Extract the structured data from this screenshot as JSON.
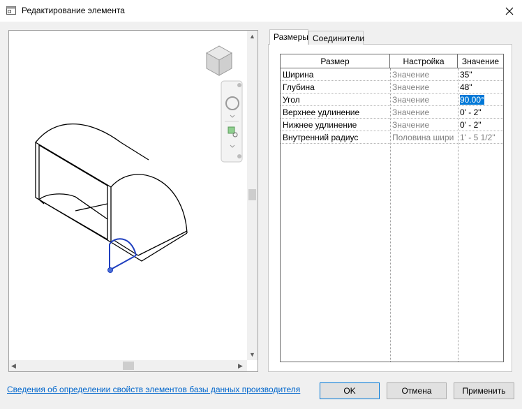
{
  "window": {
    "title": "Редактирование элемента"
  },
  "tabs": [
    {
      "label": "Размеры",
      "active": true
    },
    {
      "label": "Соединители",
      "active": false
    }
  ],
  "grid": {
    "columns": [
      "Размер",
      "Настройка",
      "Значение"
    ],
    "rows": [
      {
        "name": "Ширина",
        "setting": "Значение",
        "value": "35\""
      },
      {
        "name": "Глубина",
        "setting": "Значение",
        "value": "48\""
      },
      {
        "name": "Угол",
        "setting": "Значение",
        "value": "90.00°"
      },
      {
        "name": "Верхнее удлинение",
        "setting": "Значение",
        "value": "0' - 2\""
      },
      {
        "name": "Нижнее удлинение",
        "setting": "Значение",
        "value": "0' - 2\""
      },
      {
        "name": "Внутренний радиус",
        "setting": "Половина шири",
        "value": "1' - 5 1/2\""
      }
    ]
  },
  "footer": {
    "link": "Сведения об определении свойств элементов базы данных производителя",
    "ok": "OK",
    "cancel": "Отмена",
    "apply": "Применить"
  },
  "colors": {
    "selection": "#0078d7",
    "link": "#0066cc",
    "element_highlight": "#1f3fbf"
  }
}
